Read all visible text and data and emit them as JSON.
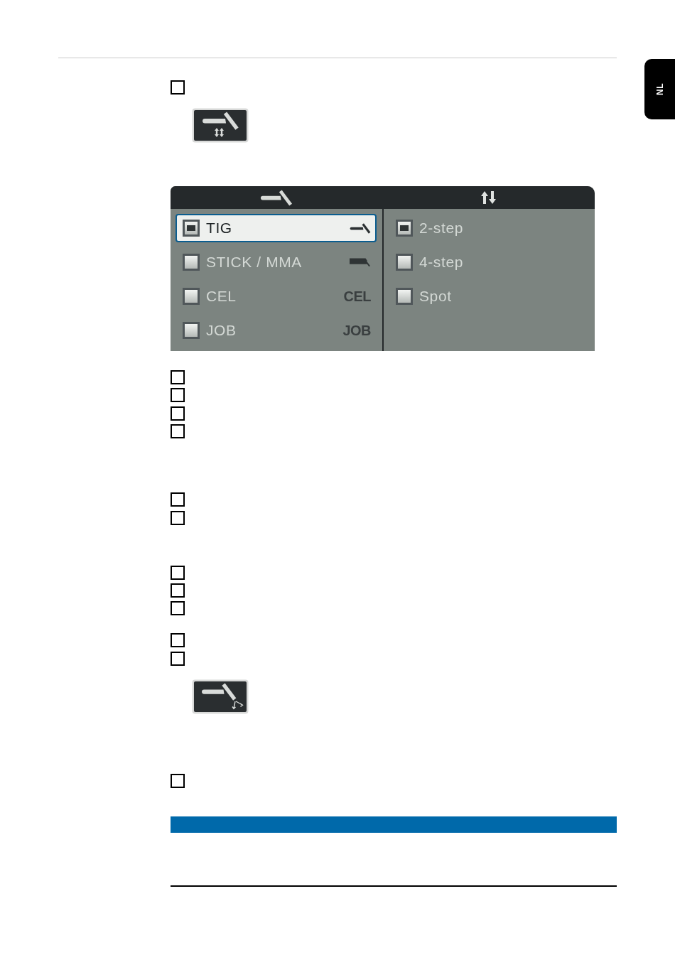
{
  "language_tab": {
    "label": "NL"
  },
  "step_groups": [
    {
      "steps": [
        {
          "checked": false
        }
      ]
    },
    {
      "steps": [
        {
          "checked": false
        },
        {
          "checked": false
        },
        {
          "checked": false
        },
        {
          "checked": false
        }
      ]
    },
    {
      "steps": [
        {
          "checked": false
        },
        {
          "checked": false
        }
      ]
    },
    {
      "steps": [
        {
          "checked": false
        },
        {
          "checked": false
        },
        {
          "checked": false
        }
      ]
    },
    {
      "steps": [
        {
          "checked": false
        },
        {
          "checked": false
        }
      ]
    },
    {
      "steps": [
        {
          "checked": false
        }
      ]
    }
  ],
  "display": {
    "columns": [
      {
        "options": [
          {
            "label": "TIG",
            "kind": "torch",
            "selected": true,
            "focused": true
          },
          {
            "label": "STICK / MMA",
            "kind": "holder",
            "selected": false,
            "focused": false
          },
          {
            "label": "CEL",
            "kind": "text",
            "symbol": "CEL",
            "selected": false,
            "focused": false
          },
          {
            "label": "JOB",
            "kind": "text",
            "symbol": "JOB",
            "selected": false,
            "focused": false
          }
        ]
      },
      {
        "options": [
          {
            "label": "2-step",
            "selected": true,
            "focused": false
          },
          {
            "label": "4-step",
            "selected": false,
            "focused": false
          },
          {
            "label": "Spot",
            "selected": false,
            "focused": false
          }
        ]
      }
    ]
  }
}
